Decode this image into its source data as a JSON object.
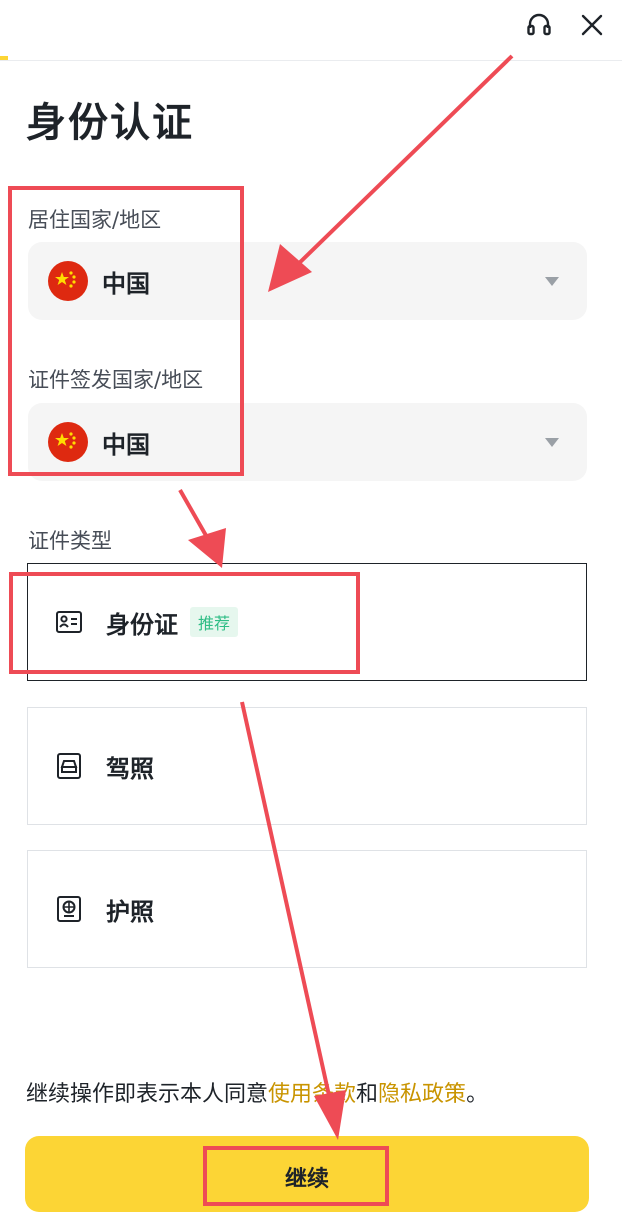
{
  "header": {
    "headset_icon": "headset-icon",
    "close_icon": "close-icon"
  },
  "page_title": "身份认证",
  "residence": {
    "label": "居住国家/地区",
    "value": "中国",
    "flag": "china-flag"
  },
  "issuing": {
    "label": "证件签发国家/地区",
    "value": "中国",
    "flag": "china-flag"
  },
  "doc_type": {
    "label": "证件类型",
    "options": [
      {
        "label": "身份证",
        "badge": "推荐",
        "icon": "id-card-icon",
        "selected": true
      },
      {
        "label": "驾照",
        "icon": "drivers-license-icon",
        "selected": false
      },
      {
        "label": "护照",
        "icon": "passport-icon",
        "selected": false
      }
    ]
  },
  "terms": {
    "prefix": "继续操作即表示本人同意",
    "link1": "使用条款",
    "conj": "和",
    "link2": "隐私政策",
    "suffix": "。"
  },
  "continue_label": "继续",
  "colors": {
    "accent": "#fcd535",
    "annotation": "#ee4b55",
    "link": "#c99400",
    "badge": "#2ebd85"
  }
}
